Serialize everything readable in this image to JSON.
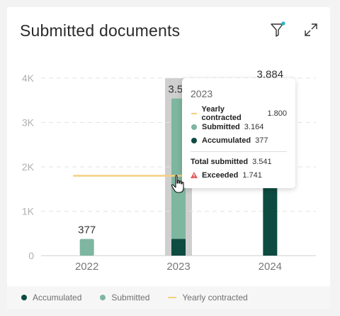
{
  "widget": {
    "title": "Submitted documents",
    "icons": {
      "filter": "filter-icon",
      "expand": "expand-icon",
      "alert": "warning-triangle-icon",
      "cursor": "hand-pointer-icon"
    }
  },
  "colors": {
    "accumulated": "#0e4b40",
    "submitted": "#7eb6a0",
    "contracted": "#f5cf80",
    "highlight": "#cfcfcf",
    "filter_badge": "#29b6c6",
    "alert": "#e05a5a"
  },
  "chart_data": {
    "type": "bar",
    "stacked": true,
    "categories": [
      "2022",
      "2023",
      "2024"
    ],
    "series": [
      {
        "name": "Accumulated",
        "values": [
          0,
          377,
          3884
        ]
      },
      {
        "name": "Submitted",
        "values": [
          377,
          3164,
          0
        ]
      }
    ],
    "reference_line": {
      "name": "Yearly contracted",
      "value": 1800,
      "categories": [
        "2022",
        "2023"
      ]
    },
    "total_labels": [
      "377",
      "3.54",
      "3.884"
    ],
    "y_ticks": [
      {
        "value": 0,
        "label": "0"
      },
      {
        "value": 1000,
        "label": "1K"
      },
      {
        "value": 2000,
        "label": "2K"
      },
      {
        "value": 3000,
        "label": "3K"
      },
      {
        "value": 4000,
        "label": "4K"
      }
    ],
    "ylim": [
      0,
      4000
    ],
    "grid": true,
    "highlighted_category": "2023",
    "legend_position": "bottom"
  },
  "legend": [
    {
      "label": "Accumulated",
      "marker": "dot",
      "color_key": "accumulated"
    },
    {
      "label": "Submitted",
      "marker": "dot",
      "color_key": "submitted"
    },
    {
      "label": "Yearly contracted",
      "marker": "dash",
      "color_key": "contracted"
    }
  ],
  "tooltip": {
    "title": "2023",
    "rows": [
      {
        "label": "Yearly contracted",
        "value": "1.800",
        "marker": "dash",
        "color_key": "contracted"
      },
      {
        "label": "Submitted",
        "value": "3.164",
        "marker": "dot",
        "color_key": "submitted"
      },
      {
        "label": "Accumulated",
        "value": "377",
        "marker": "dot",
        "color_key": "accumulated"
      }
    ],
    "total": {
      "label": "Total submitted",
      "value": "3.541"
    },
    "exceeded": {
      "label": "Exceeded",
      "value": "1.741"
    }
  }
}
